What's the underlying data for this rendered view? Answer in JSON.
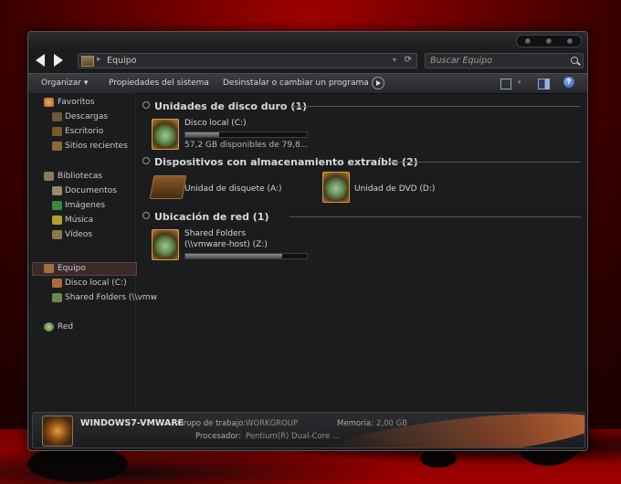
{
  "window": {
    "address": {
      "location": "Equipo"
    },
    "search": {
      "placeholder": "Buscar Equipo"
    }
  },
  "toolbar": {
    "organize": "Organizar",
    "system_properties": "Propiedades del sistema",
    "uninstall": "Desinstalar o cambiar un programa"
  },
  "sidebar": {
    "favorites": {
      "label": "Favoritos",
      "items": [
        "Descargas",
        "Escritorio",
        "Sitios recientes"
      ]
    },
    "libraries": {
      "label": "Bibliotecas",
      "items": [
        "Documentos",
        "Imágenes",
        "Música",
        "Vídeos"
      ]
    },
    "computer": {
      "label": "Equipo",
      "items": [
        "Disco local (C:)",
        "Shared Folders (\\\\vmw"
      ]
    },
    "network": {
      "label": "Red"
    }
  },
  "content": {
    "hard_drives": {
      "heading": "Unidades de disco duro (1)",
      "items": [
        {
          "name": "Disco local (C:)",
          "free": "57,2 GB disponibles de 79,8...",
          "used_fraction": 0.28
        }
      ]
    },
    "removable": {
      "heading": "Dispositivos con almacenamiento extraíble (2)",
      "items": [
        {
          "name": "Unidad de disquete (A:)"
        },
        {
          "name": "Unidad de DVD (D:)"
        }
      ]
    },
    "network_locations": {
      "heading": "Ubicación de red (1)",
      "items": [
        {
          "name_line1": "Shared Folders",
          "name_line2": "(\\\\vmware-host) (Z:)",
          "used_fraction": 0.8
        }
      ]
    }
  },
  "details": {
    "computer_name": "WINDOWS7-VMWARE",
    "workgroup_label": "Grupo de trabajo:",
    "workgroup_value": "WORKGROUP",
    "memory_label": "Memoria:",
    "memory_value": "2,00 GB",
    "processor_label": "Procesador:",
    "processor_value": "Pentium(R) Dual-Core ..."
  }
}
